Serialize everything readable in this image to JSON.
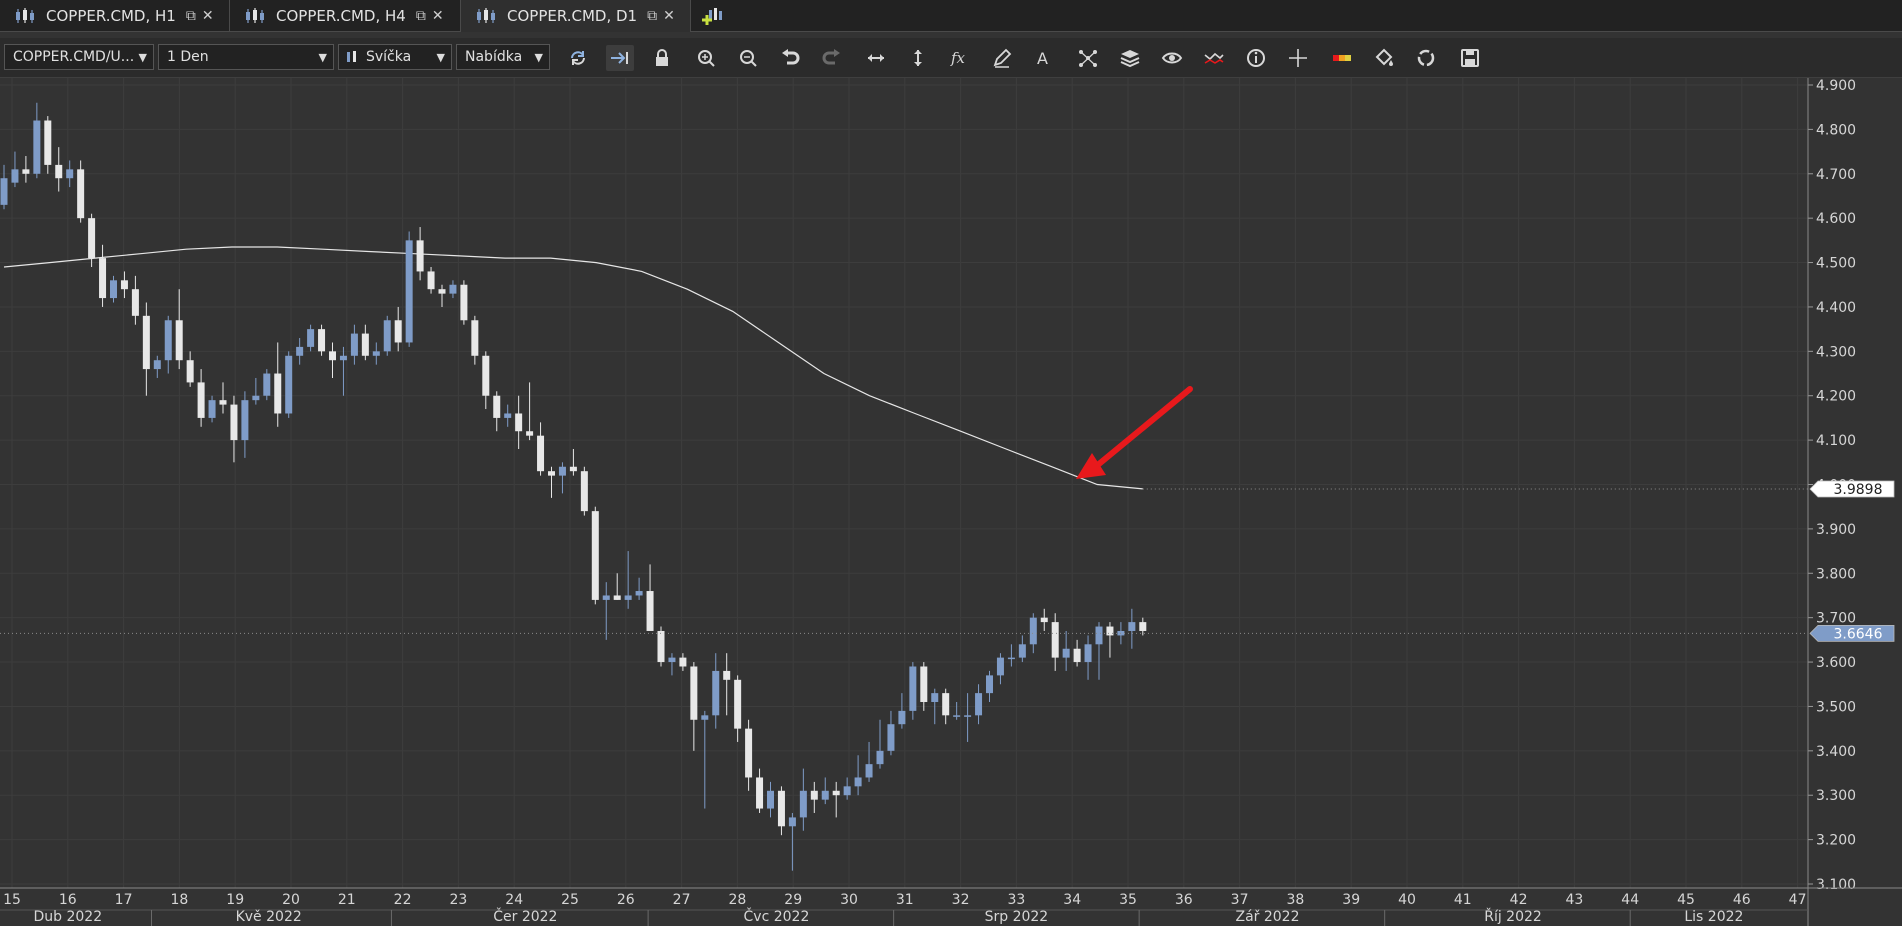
{
  "tabs": [
    {
      "title": "COPPER.CMD, H1",
      "active": false
    },
    {
      "title": "COPPER.CMD, H4",
      "active": false
    },
    {
      "title": "COPPER.CMD, D1",
      "active": true
    }
  ],
  "tab_controls": {
    "popout_glyph": "⧉",
    "close_glyph": "✕"
  },
  "toolbar": {
    "symbol_select": "COPPER.CMD/U...",
    "timeframe_select": "1 Den",
    "chart_type_select": "Svíčka",
    "price_type_select": "Nabídka",
    "tools": [
      "refresh-icon",
      "autoscroll-icon",
      "lock-icon",
      "zoom-in-icon",
      "zoom-out-icon",
      "undo-icon",
      "redo-icon",
      "horizontal-scale-icon",
      "vertical-scale-icon",
      "indicator-fx-icon",
      "pencil-icon",
      "text-icon",
      "pattern-icon",
      "layers-icon",
      "eye-icon",
      "signal-icon",
      "info-icon",
      "crosshair-icon",
      "ruler-icon",
      "paint-bucket-icon",
      "cycle-icon",
      "save-icon"
    ]
  },
  "colors": {
    "background": "#333333",
    "bull": "#7f9cc8",
    "bear": "#e8e8e8",
    "ma_line": "#e6e6e6",
    "arrow": "#e8191c",
    "grid": "#3d3d3d",
    "price_tag": "#7f9cc8"
  },
  "chart_data": {
    "type": "candlestick",
    "instrument": "COPPER.CMD",
    "timeframe": "D1",
    "ylim": [
      3.1,
      4.9
    ],
    "y_ticks": [
      "4.900",
      "4.800",
      "4.700",
      "4.600",
      "4.500",
      "4.400",
      "4.300",
      "4.200",
      "4.100",
      "4.000",
      "3.900",
      "3.800",
      "3.700",
      "3.600",
      "3.500",
      "3.400",
      "3.300",
      "3.200",
      "3.100"
    ],
    "week_ticks": [
      "15",
      "16",
      "17",
      "18",
      "19",
      "20",
      "21",
      "22",
      "23",
      "24",
      "25",
      "26",
      "27",
      "28",
      "29",
      "30",
      "31",
      "32",
      "33",
      "34",
      "35",
      "36",
      "37",
      "38",
      "39",
      "40",
      "41",
      "42",
      "43",
      "44",
      "45",
      "46",
      "47"
    ],
    "month_labels": [
      "Dub 2022",
      "Kvě 2022",
      "Čer 2022",
      "Čvc 2022",
      "Srp 2022",
      "Zář 2022",
      "Říj 2022",
      "Lis 2022"
    ],
    "last_price": "3.6646",
    "ma_price": "3.9898",
    "candles": [
      {
        "o": 4.63,
        "h": 4.72,
        "l": 4.62,
        "c": 4.69
      },
      {
        "o": 4.68,
        "h": 4.75,
        "l": 4.67,
        "c": 4.71
      },
      {
        "o": 4.71,
        "h": 4.74,
        "l": 4.68,
        "c": 4.7
      },
      {
        "o": 4.7,
        "h": 4.86,
        "l": 4.69,
        "c": 4.82
      },
      {
        "o": 4.82,
        "h": 4.83,
        "l": 4.7,
        "c": 4.72
      },
      {
        "o": 4.72,
        "h": 4.76,
        "l": 4.66,
        "c": 4.69
      },
      {
        "o": 4.69,
        "h": 4.73,
        "l": 4.67,
        "c": 4.71
      },
      {
        "o": 4.71,
        "h": 4.73,
        "l": 4.59,
        "c": 4.6
      },
      {
        "o": 4.6,
        "h": 4.61,
        "l": 4.49,
        "c": 4.51
      },
      {
        "o": 4.51,
        "h": 4.54,
        "l": 4.4,
        "c": 4.42
      },
      {
        "o": 4.42,
        "h": 4.47,
        "l": 4.41,
        "c": 4.46
      },
      {
        "o": 4.46,
        "h": 4.48,
        "l": 4.42,
        "c": 4.44
      },
      {
        "o": 4.44,
        "h": 4.47,
        "l": 4.36,
        "c": 4.38
      },
      {
        "o": 4.38,
        "h": 4.41,
        "l": 4.2,
        "c": 4.26
      },
      {
        "o": 4.26,
        "h": 4.29,
        "l": 4.24,
        "c": 4.28
      },
      {
        "o": 4.28,
        "h": 4.38,
        "l": 4.25,
        "c": 4.37
      },
      {
        "o": 4.37,
        "h": 4.44,
        "l": 4.26,
        "c": 4.28
      },
      {
        "o": 4.28,
        "h": 4.3,
        "l": 4.22,
        "c": 4.23
      },
      {
        "o": 4.23,
        "h": 4.26,
        "l": 4.13,
        "c": 4.15
      },
      {
        "o": 4.15,
        "h": 4.2,
        "l": 4.14,
        "c": 4.19
      },
      {
        "o": 4.19,
        "h": 4.23,
        "l": 4.16,
        "c": 4.18
      },
      {
        "o": 4.18,
        "h": 4.2,
        "l": 4.05,
        "c": 4.1
      },
      {
        "o": 4.1,
        "h": 4.21,
        "l": 4.06,
        "c": 4.19
      },
      {
        "o": 4.19,
        "h": 4.24,
        "l": 4.18,
        "c": 4.2
      },
      {
        "o": 4.2,
        "h": 4.26,
        "l": 4.19,
        "c": 4.25
      },
      {
        "o": 4.25,
        "h": 4.32,
        "l": 4.13,
        "c": 4.16
      },
      {
        "o": 4.16,
        "h": 4.3,
        "l": 4.15,
        "c": 4.29
      },
      {
        "o": 4.29,
        "h": 4.33,
        "l": 4.27,
        "c": 4.31
      },
      {
        "o": 4.31,
        "h": 4.36,
        "l": 4.3,
        "c": 4.35
      },
      {
        "o": 4.35,
        "h": 4.36,
        "l": 4.29,
        "c": 4.3
      },
      {
        "o": 4.3,
        "h": 4.32,
        "l": 4.24,
        "c": 4.28
      },
      {
        "o": 4.28,
        "h": 4.31,
        "l": 4.2,
        "c": 4.29
      },
      {
        "o": 4.29,
        "h": 4.36,
        "l": 4.27,
        "c": 4.34
      },
      {
        "o": 4.34,
        "h": 4.36,
        "l": 4.28,
        "c": 4.29
      },
      {
        "o": 4.29,
        "h": 4.32,
        "l": 4.27,
        "c": 4.3
      },
      {
        "o": 4.3,
        "h": 4.38,
        "l": 4.29,
        "c": 4.37
      },
      {
        "o": 4.37,
        "h": 4.4,
        "l": 4.3,
        "c": 4.32
      },
      {
        "o": 4.32,
        "h": 4.57,
        "l": 4.31,
        "c": 4.55
      },
      {
        "o": 4.55,
        "h": 4.58,
        "l": 4.46,
        "c": 4.48
      },
      {
        "o": 4.48,
        "h": 4.49,
        "l": 4.43,
        "c": 4.44
      },
      {
        "o": 4.44,
        "h": 4.45,
        "l": 4.4,
        "c": 4.43
      },
      {
        "o": 4.43,
        "h": 4.46,
        "l": 4.42,
        "c": 4.45
      },
      {
        "o": 4.45,
        "h": 4.46,
        "l": 4.36,
        "c": 4.37
      },
      {
        "o": 4.37,
        "h": 4.38,
        "l": 4.27,
        "c": 4.29
      },
      {
        "o": 4.29,
        "h": 4.3,
        "l": 4.17,
        "c": 4.2
      },
      {
        "o": 4.2,
        "h": 4.21,
        "l": 4.12,
        "c": 4.15
      },
      {
        "o": 4.15,
        "h": 4.18,
        "l": 4.13,
        "c": 4.16
      },
      {
        "o": 4.16,
        "h": 4.2,
        "l": 4.08,
        "c": 4.12
      },
      {
        "o": 4.12,
        "h": 4.23,
        "l": 4.1,
        "c": 4.11
      },
      {
        "o": 4.11,
        "h": 4.14,
        "l": 4.02,
        "c": 4.03
      },
      {
        "o": 4.03,
        "h": 4.04,
        "l": 3.97,
        "c": 4.02
      },
      {
        "o": 4.02,
        "h": 4.05,
        "l": 3.98,
        "c": 4.04
      },
      {
        "o": 4.04,
        "h": 4.08,
        "l": 4.02,
        "c": 4.03
      },
      {
        "o": 4.03,
        "h": 4.04,
        "l": 3.93,
        "c": 3.94
      },
      {
        "o": 3.94,
        "h": 3.95,
        "l": 3.73,
        "c": 3.74
      },
      {
        "o": 3.74,
        "h": 3.78,
        "l": 3.65,
        "c": 3.75
      },
      {
        "o": 3.75,
        "h": 3.8,
        "l": 3.74,
        "c": 3.74
      },
      {
        "o": 3.74,
        "h": 3.85,
        "l": 3.72,
        "c": 3.75
      },
      {
        "o": 3.75,
        "h": 3.79,
        "l": 3.74,
        "c": 3.76
      },
      {
        "o": 3.76,
        "h": 3.82,
        "l": 3.7,
        "c": 3.67
      },
      {
        "o": 3.67,
        "h": 3.68,
        "l": 3.59,
        "c": 3.6
      },
      {
        "o": 3.6,
        "h": 3.62,
        "l": 3.57,
        "c": 3.61
      },
      {
        "o": 3.61,
        "h": 3.62,
        "l": 3.58,
        "c": 3.59
      },
      {
        "o": 3.59,
        "h": 3.6,
        "l": 3.4,
        "c": 3.47
      },
      {
        "o": 3.47,
        "h": 3.49,
        "l": 3.27,
        "c": 3.48
      },
      {
        "o": 3.48,
        "h": 3.62,
        "l": 3.45,
        "c": 3.58
      },
      {
        "o": 3.58,
        "h": 3.62,
        "l": 3.48,
        "c": 3.56
      },
      {
        "o": 3.56,
        "h": 3.57,
        "l": 3.42,
        "c": 3.45
      },
      {
        "o": 3.45,
        "h": 3.47,
        "l": 3.31,
        "c": 3.34
      },
      {
        "o": 3.34,
        "h": 3.36,
        "l": 3.26,
        "c": 3.27
      },
      {
        "o": 3.27,
        "h": 3.33,
        "l": 3.25,
        "c": 3.31
      },
      {
        "o": 3.31,
        "h": 3.32,
        "l": 3.21,
        "c": 3.23
      },
      {
        "o": 3.23,
        "h": 3.26,
        "l": 3.13,
        "c": 3.25
      },
      {
        "o": 3.25,
        "h": 3.36,
        "l": 3.22,
        "c": 3.31
      },
      {
        "o": 3.31,
        "h": 3.33,
        "l": 3.26,
        "c": 3.29
      },
      {
        "o": 3.29,
        "h": 3.34,
        "l": 3.28,
        "c": 3.31
      },
      {
        "o": 3.31,
        "h": 3.33,
        "l": 3.25,
        "c": 3.3
      },
      {
        "o": 3.3,
        "h": 3.34,
        "l": 3.29,
        "c": 3.32
      },
      {
        "o": 3.32,
        "h": 3.39,
        "l": 3.3,
        "c": 3.34
      },
      {
        "o": 3.34,
        "h": 3.42,
        "l": 3.33,
        "c": 3.37
      },
      {
        "o": 3.37,
        "h": 3.47,
        "l": 3.36,
        "c": 3.4
      },
      {
        "o": 3.4,
        "h": 3.49,
        "l": 3.39,
        "c": 3.46
      },
      {
        "o": 3.46,
        "h": 3.53,
        "l": 3.45,
        "c": 3.49
      },
      {
        "o": 3.49,
        "h": 3.6,
        "l": 3.47,
        "c": 3.59
      },
      {
        "o": 3.59,
        "h": 3.6,
        "l": 3.49,
        "c": 3.51
      },
      {
        "o": 3.51,
        "h": 3.54,
        "l": 3.46,
        "c": 3.53
      },
      {
        "o": 3.53,
        "h": 3.54,
        "l": 3.46,
        "c": 3.48
      },
      {
        "o": 3.48,
        "h": 3.51,
        "l": 3.47,
        "c": 3.48
      },
      {
        "o": 3.48,
        "h": 3.53,
        "l": 3.42,
        "c": 3.48
      },
      {
        "o": 3.48,
        "h": 3.55,
        "l": 3.46,
        "c": 3.53
      },
      {
        "o": 3.53,
        "h": 3.58,
        "l": 3.51,
        "c": 3.57
      },
      {
        "o": 3.57,
        "h": 3.62,
        "l": 3.55,
        "c": 3.61
      },
      {
        "o": 3.61,
        "h": 3.64,
        "l": 3.59,
        "c": 3.61
      },
      {
        "o": 3.61,
        "h": 3.66,
        "l": 3.6,
        "c": 3.64
      },
      {
        "o": 3.64,
        "h": 3.71,
        "l": 3.62,
        "c": 3.7
      },
      {
        "o": 3.7,
        "h": 3.72,
        "l": 3.67,
        "c": 3.69
      },
      {
        "o": 3.69,
        "h": 3.71,
        "l": 3.58,
        "c": 3.61
      },
      {
        "o": 3.61,
        "h": 3.67,
        "l": 3.58,
        "c": 3.63
      },
      {
        "o": 3.63,
        "h": 3.65,
        "l": 3.59,
        "c": 3.6
      },
      {
        "o": 3.6,
        "h": 3.66,
        "l": 3.56,
        "c": 3.64
      },
      {
        "o": 3.64,
        "h": 3.69,
        "l": 3.56,
        "c": 3.68
      },
      {
        "o": 3.68,
        "h": 3.69,
        "l": 3.61,
        "c": 3.66
      },
      {
        "o": 3.66,
        "h": 3.69,
        "l": 3.64,
        "c": 3.67
      },
      {
        "o": 3.67,
        "h": 3.72,
        "l": 3.63,
        "c": 3.69
      },
      {
        "o": 3.69,
        "h": 3.7,
        "l": 3.66,
        "c": 3.67
      }
    ],
    "ma": [
      4.49,
      4.5,
      4.51,
      4.52,
      4.53,
      4.535,
      4.535,
      4.53,
      4.525,
      4.52,
      4.515,
      4.51,
      4.51,
      4.5,
      4.48,
      4.44,
      4.39,
      4.32,
      4.25,
      4.2,
      4.16,
      4.12,
      4.08,
      4.04,
      4.0,
      3.99
    ]
  }
}
